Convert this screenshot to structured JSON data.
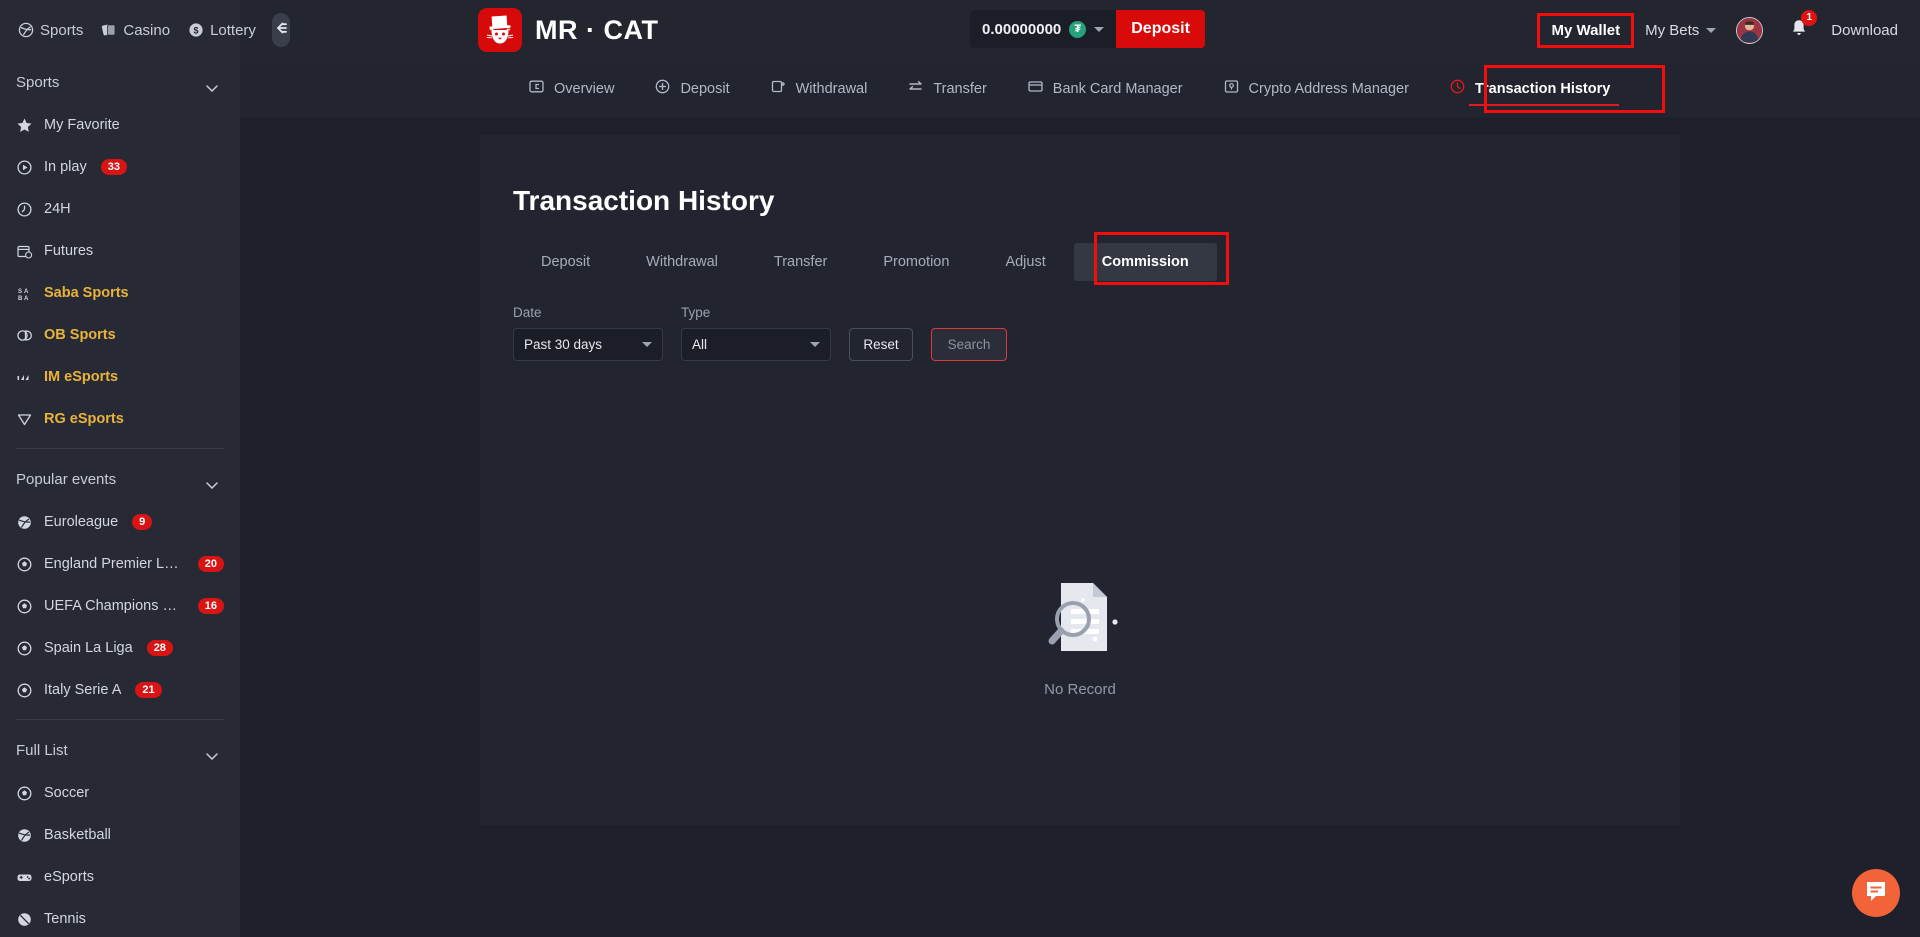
{
  "header": {
    "left_nav": [
      {
        "label": "Sports",
        "icon": "sports-ball-icon"
      },
      {
        "label": "Casino",
        "icon": "casino-cards-icon"
      },
      {
        "label": "Lottery",
        "icon": "lottery-coin-icon"
      }
    ],
    "collapse_icon": "collapse-sidebar-icon",
    "brand": "MR · CAT",
    "balance": "0.00000000",
    "currency_symbol": "₮",
    "currency_name": "USDT",
    "deposit_label": "Deposit",
    "my_wallet_label": "My Wallet",
    "my_bets_label": "My Bets",
    "notification_count": "1",
    "download_label": "Download",
    "accent_red": "#d90a0a",
    "highlight_red": "#f30d0d"
  },
  "subnav": {
    "items": [
      {
        "label": "Overview",
        "icon": "overview-icon",
        "active": false
      },
      {
        "label": "Deposit",
        "icon": "deposit-icon",
        "active": false
      },
      {
        "label": "Withdrawal",
        "icon": "withdrawal-icon",
        "active": false
      },
      {
        "label": "Transfer",
        "icon": "transfer-icon",
        "active": false
      },
      {
        "label": "Bank Card Manager",
        "icon": "bank-card-icon",
        "active": false
      },
      {
        "label": "Crypto Address Manager",
        "icon": "crypto-address-icon",
        "active": false
      },
      {
        "label": "Transaction History",
        "icon": "clock-history-icon",
        "active": true
      }
    ]
  },
  "sidebar": {
    "sports_header": "Sports",
    "sports_items": [
      {
        "label": "My Favorite",
        "icon": "star-icon",
        "badge": "",
        "gold": false
      },
      {
        "label": "In play",
        "icon": "play-circle-icon",
        "badge": "33",
        "gold": false
      },
      {
        "label": "24H",
        "icon": "clock-24h-icon",
        "badge": "",
        "gold": false
      },
      {
        "label": "Futures",
        "icon": "calendar-icon",
        "badge": "",
        "gold": false
      },
      {
        "label": "Saba Sports",
        "icon": "saba-icon",
        "badge": "",
        "gold": true
      },
      {
        "label": "OB Sports",
        "icon": "ob-icon",
        "badge": "",
        "gold": true
      },
      {
        "label": "IM eSports",
        "icon": "im-esports-icon",
        "badge": "",
        "gold": true
      },
      {
        "label": "RG eSports",
        "icon": "rg-esports-icon",
        "badge": "",
        "gold": true
      }
    ],
    "popular_header": "Popular events",
    "popular_items": [
      {
        "label": "Euroleague",
        "icon": "basketball-icon",
        "badge": "9",
        "gold": false
      },
      {
        "label": "England Premier Lea...",
        "icon": "soccer-icon",
        "badge": "20",
        "gold": false
      },
      {
        "label": "UEFA Champions Lea...",
        "icon": "soccer-icon",
        "badge": "16",
        "gold": false
      },
      {
        "label": "Spain La Liga",
        "icon": "soccer-icon",
        "badge": "28",
        "gold": false
      },
      {
        "label": "Italy Serie A",
        "icon": "soccer-icon",
        "badge": "21",
        "gold": false
      }
    ],
    "fulllist_header": "Full List",
    "fulllist_items": [
      {
        "label": "Soccer",
        "icon": "soccer-icon",
        "badge": "",
        "gold": false
      },
      {
        "label": "Basketball",
        "icon": "basketball-icon",
        "badge": "",
        "gold": false
      },
      {
        "label": "eSports",
        "icon": "esports-icon",
        "badge": "",
        "gold": false
      },
      {
        "label": "Tennis",
        "icon": "tennis-icon",
        "badge": "",
        "gold": false
      }
    ]
  },
  "main": {
    "page_title": "Transaction History",
    "tabs": [
      {
        "label": "Deposit",
        "active": false
      },
      {
        "label": "Withdrawal",
        "active": false
      },
      {
        "label": "Transfer",
        "active": false
      },
      {
        "label": "Promotion",
        "active": false
      },
      {
        "label": "Adjust",
        "active": false
      },
      {
        "label": "Commission",
        "active": true
      }
    ],
    "filters": {
      "date_label": "Date",
      "date_value": "Past 30 days",
      "type_label": "Type",
      "type_value": "All",
      "reset_label": "Reset",
      "search_label": "Search"
    },
    "empty_state": {
      "icon": "no-record-document-search-icon",
      "text": "No Record"
    }
  },
  "chat": {
    "icon": "chat-bubble-icon",
    "color": "#f2633a"
  }
}
